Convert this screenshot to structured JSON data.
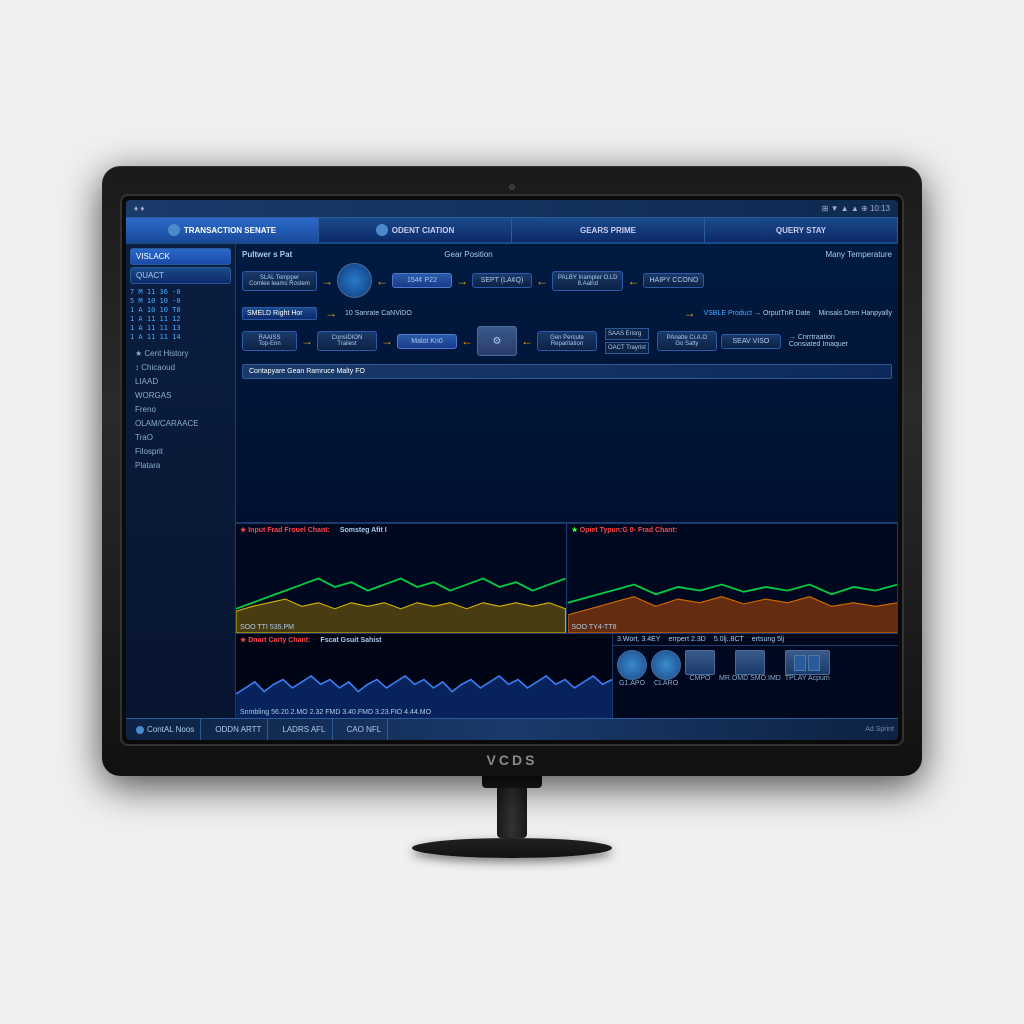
{
  "monitor": {
    "brand": "VCDS",
    "webcam_label": "webcam"
  },
  "statusbar": {
    "left": "♦ ♦",
    "right": "⊞ ▼ ▲ ▲ ⊕  10:13"
  },
  "nav_tabs": [
    {
      "id": "tab1",
      "label": "TRANSACTION SENATE",
      "active": true
    },
    {
      "id": "tab2",
      "label": "ODENT CIATION"
    },
    {
      "id": "tab3",
      "label": "GEARS PRIME"
    },
    {
      "id": "tab4",
      "label": "QUERY STAY"
    }
  ],
  "sidebar": {
    "buttons": [
      {
        "id": "btn1",
        "label": "VISLACK",
        "active": true
      },
      {
        "id": "btn2",
        "label": "QUACT"
      }
    ],
    "items": [
      {
        "id": "item1",
        "label": "Cent History"
      },
      {
        "id": "item2",
        "label": "Chicaoud"
      },
      {
        "id": "item3",
        "label": "LIAAD"
      },
      {
        "id": "item4",
        "label": "WORGAS"
      },
      {
        "id": "item5",
        "label": "Freno"
      },
      {
        "id": "item6",
        "label": "OLAM/CARAACE"
      },
      {
        "id": "item7",
        "label": "TraO"
      },
      {
        "id": "item8",
        "label": "Filosprit"
      },
      {
        "id": "item9",
        "label": "Platara"
      }
    ]
  },
  "diagram": {
    "title": "Pultwer s Pat",
    "subtitle": "Gear Position",
    "subtitle2": "Many Temperature",
    "row1": {
      "devices": [
        "SLAL Tempper\nComlee leams Rostem",
        "154¢ P22",
        "SEPT (LA¢Q)",
        "PALBY Inampler O.LD\n8.Aalnd",
        "HAIPY CCONO"
      ]
    },
    "row2": {
      "label": "SMELD Right Hor",
      "center": "10 Sanrate CaNViDO",
      "right": "OrputTnR Date",
      "far_right": "Minsals Dren Hanpyally"
    },
    "row3": {
      "devices": [
        "RAAISS Top-Enn",
        "ConsIDION Trailest",
        "Malot Kn0",
        "Gen Percute Reparitation",
        "PAnatte Ci.A.O\nGo Salty",
        "SEAV VISTO"
      ]
    },
    "row4": {
      "label": "Contapyare Gean Ramruce Malty FO",
      "sub1": "SAAS Erisrg",
      "sub2": "OACT Trayrist",
      "sub3": "Cnrrtraation Consiated Imaquer"
    },
    "chart1": {
      "label": "Input Frad Frouel Chant:",
      "sub": "Somsteg Afit I",
      "bottom": "SOO TTI 535.PM"
    },
    "chart2": {
      "label": "Opiet Typun:G 0- Frad Chant:",
      "bottom": "SOO TY4-TT8"
    },
    "chart3": {
      "label": "Dnart Carty Chant:",
      "sub": "Fscat Gsuit Sahist",
      "bottom_readings": "Snmbling 56.20.2.MO  2.32 FMD  3.40.FMD  3.23.FIO  4.44.MO"
    }
  },
  "right_panel": {
    "readings": [
      "3.Wort, 3.4EY",
      "errpert 2.3D",
      "5.0lj..8CT",
      "ertsung 5lj"
    ],
    "icon_groups": [
      {
        "icons": [
          "G1.APO",
          "CLARO",
          "CMPO",
          "MR.OMD\nSMO.IMD",
          "TPLAY\nAcpum"
        ]
      }
    ]
  },
  "statusbar_bottom": {
    "items": [
      {
        "id": "s1",
        "icon": true,
        "label": "ContAL Noos"
      },
      {
        "id": "s2",
        "label": "ODDN ARTT"
      },
      {
        "id": "s3",
        "label": "LADRS AFL"
      },
      {
        "id": "s4",
        "label": "CAO NFL"
      },
      {
        "id": "s5",
        "label": "Ad Sprint"
      }
    ]
  }
}
